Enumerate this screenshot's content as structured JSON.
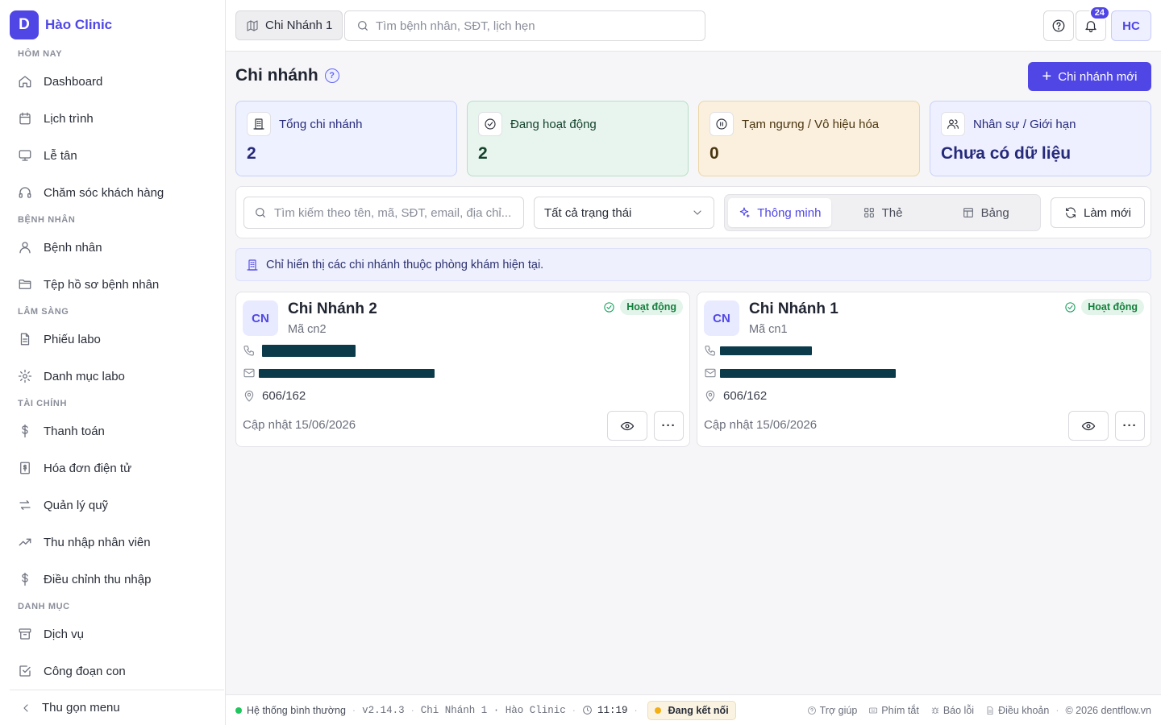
{
  "brand": {
    "logo_letter": "D",
    "name": "Hào Clinic"
  },
  "sidebar": {
    "sections": [
      {
        "title": "HÔM NAY",
        "items": [
          {
            "label": "Dashboard",
            "icon": "home-icon"
          },
          {
            "label": "Lịch trình",
            "icon": "calendar-icon"
          },
          {
            "label": "Lễ tân",
            "icon": "monitor-icon"
          },
          {
            "label": "Chăm sóc khách hàng",
            "icon": "headphones-icon"
          }
        ]
      },
      {
        "title": "BỆNH NHÂN",
        "items": [
          {
            "label": "Bệnh nhân",
            "icon": "user-icon"
          },
          {
            "label": "Tệp hồ sơ bệnh nhân",
            "icon": "folder-icon"
          }
        ]
      },
      {
        "title": "LÂM SÀNG",
        "items": [
          {
            "label": "Phiếu labo",
            "icon": "file-icon"
          },
          {
            "label": "Danh mục labo",
            "icon": "gear-icon"
          }
        ]
      },
      {
        "title": "TÀI CHÍNH",
        "items": [
          {
            "label": "Thanh toán",
            "icon": "dollar-icon"
          },
          {
            "label": "Hóa đơn điện tử",
            "icon": "invoice-icon"
          },
          {
            "label": "Quản lý quỹ",
            "icon": "transfer-icon"
          },
          {
            "label": "Thu nhập nhân viên",
            "icon": "trending-up-icon"
          },
          {
            "label": "Điều chỉnh thu nhập",
            "icon": "dollar-icon"
          }
        ]
      },
      {
        "title": "DANH MỤC",
        "items": [
          {
            "label": "Dịch vụ",
            "icon": "archive-icon"
          },
          {
            "label": "Công đoạn con",
            "icon": "checkbox-icon"
          }
        ]
      }
    ],
    "collapse_label": "Thu gọn menu"
  },
  "header": {
    "branch_label": "Chi Nhánh 1",
    "search_placeholder": "Tìm bệnh nhân, SĐT, lịch hẹn",
    "notification_count": "24",
    "avatar_initials": "HC"
  },
  "page": {
    "title": "Chi nhánh",
    "help_glyph": "?",
    "new_button_label": "Chi nhánh mới"
  },
  "stats": [
    {
      "label": "Tổng chi nhánh",
      "value": "2",
      "icon": "building-icon"
    },
    {
      "label": "Đang hoạt động",
      "value": "2",
      "icon": "check-circle-icon"
    },
    {
      "label": "Tạm ngưng / Vô hiệu hóa",
      "value": "0",
      "icon": "pause-circle-icon"
    },
    {
      "label": "Nhân sự / Giới hạn",
      "value": "Chưa có dữ liệu",
      "icon": "users-icon"
    }
  ],
  "filters": {
    "search_placeholder": "Tìm kiếm theo tên, mã, SĐT, email, địa chỉ...",
    "status_select": "Tất cả trạng thái",
    "view_tabs": [
      {
        "label": "Thông minh",
        "icon": "sparkle-icon",
        "active": true
      },
      {
        "label": "Thẻ",
        "icon": "grid-icon",
        "active": false
      },
      {
        "label": "Bảng",
        "icon": "table-icon",
        "active": false
      }
    ],
    "refresh_label": "Làm mới"
  },
  "info_banner": "Chỉ hiển thị các chi nhánh thuộc phòng khám hiện tại.",
  "branches": [
    {
      "initials": "CN",
      "name": "Chi Nhánh 2",
      "code": "Mã cn2",
      "status": "Hoạt động",
      "address": "606/162",
      "updated": "Cập nhật 15/06/2026"
    },
    {
      "initials": "CN",
      "name": "Chi Nhánh 1",
      "code": "Mã cn1",
      "status": "Hoạt động",
      "address": "606/162",
      "updated": "Cập nhật 15/06/2026"
    }
  ],
  "footer": {
    "system_status": "Hệ thống bình thường",
    "version": "v2.14.3",
    "context": "Chi Nhánh 1 · Hào Clinic",
    "time": "11:19",
    "connection": "Đang kết nối",
    "links": [
      "Trợ giúp",
      "Phím tắt",
      "Báo lỗi",
      "Điều khoản"
    ],
    "copyright": "© 2026 dentflow.vn"
  },
  "colors": {
    "accent": "#4f46e5",
    "success": "#15803d",
    "warning": "#f2b016"
  }
}
